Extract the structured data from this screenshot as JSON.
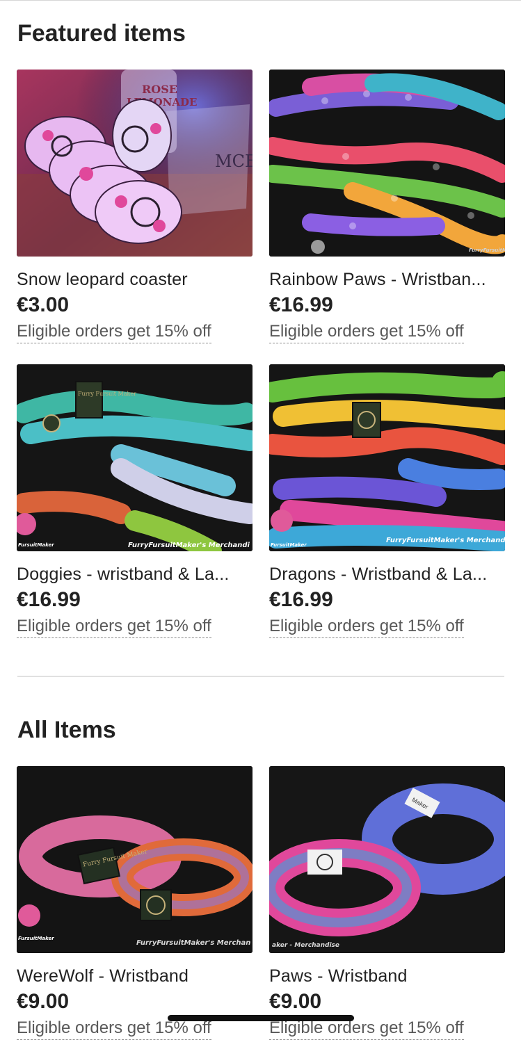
{
  "featured": {
    "title": "Featured items",
    "items": [
      {
        "title": "Snow leopard coaster",
        "price": "€3.00",
        "promo": "Eligible orders get 15% off",
        "image_icon": "coaster-image"
      },
      {
        "title": "Rainbow Paws - Wristban...",
        "price": "€16.99",
        "promo": "Eligible orders get 15% off",
        "image_icon": "wristband-image"
      },
      {
        "title": "Doggies - wristband & La...",
        "price": "€16.99",
        "promo": "Eligible orders get 15% off",
        "image_icon": "lanyard-image"
      },
      {
        "title": "Dragons - Wristband & La...",
        "price": "€16.99",
        "promo": "Eligible orders get 15% off",
        "image_icon": "lanyard-image"
      }
    ]
  },
  "all_items": {
    "title": "All Items",
    "items": [
      {
        "title": "WereWolf - Wristband",
        "price": "€9.00",
        "promo": "Eligible orders get 15% off",
        "image_icon": "wristband-image"
      },
      {
        "title": "Paws - Wristband",
        "price": "€9.00",
        "promo": "Eligible orders get 15% off",
        "image_icon": "wristband-image"
      }
    ]
  },
  "images": {
    "coaster": {
      "text_rose": "ROSE",
      "text_lemonade": "LEMONADE",
      "text_glass": "MCE"
    },
    "rainbow": {
      "watermark": "FurryFursuitMaker"
    },
    "doggies": {
      "watermark": "FurryFursuitMaker's Merchandi",
      "tag_text": "Furry Fursuit Maker",
      "logo_text": "FursuitMaker"
    },
    "dragons": {
      "watermark": "FurryFursuitMaker's Merchand",
      "logo_text": "FursuitMaker"
    },
    "werewolf": {
      "watermark": "FurryFursuitMaker's Merchan",
      "tag_text": "Furry Fursuit Maker",
      "logo_text": "FursuitMaker"
    },
    "paws": {
      "watermark": "aker - Merchandise",
      "tag_text": "Maker"
    }
  },
  "colors": {
    "text": "#222222",
    "muted": "#595959",
    "divider": "#e1e1e1"
  }
}
